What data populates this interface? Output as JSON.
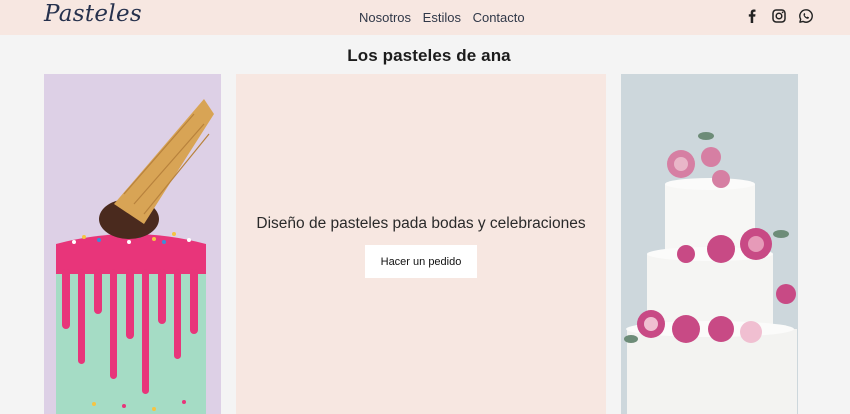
{
  "header": {
    "logo": "Pasteles",
    "nav": [
      "Nosotros",
      "Estilos",
      "Contacto"
    ],
    "social_icons": [
      "facebook-icon",
      "instagram-icon",
      "whatsapp-icon"
    ]
  },
  "main": {
    "title": "Los pasteles de ana",
    "tagline": "Diseño de pasteles pada bodas y celebraciones",
    "cta_label": "Hacer un pedido"
  },
  "colors": {
    "header_bg": "#f7e7e1",
    "page_bg": "#f4f4f4",
    "accent_pink": "#e8357a",
    "mint": "#9fd8c0"
  }
}
